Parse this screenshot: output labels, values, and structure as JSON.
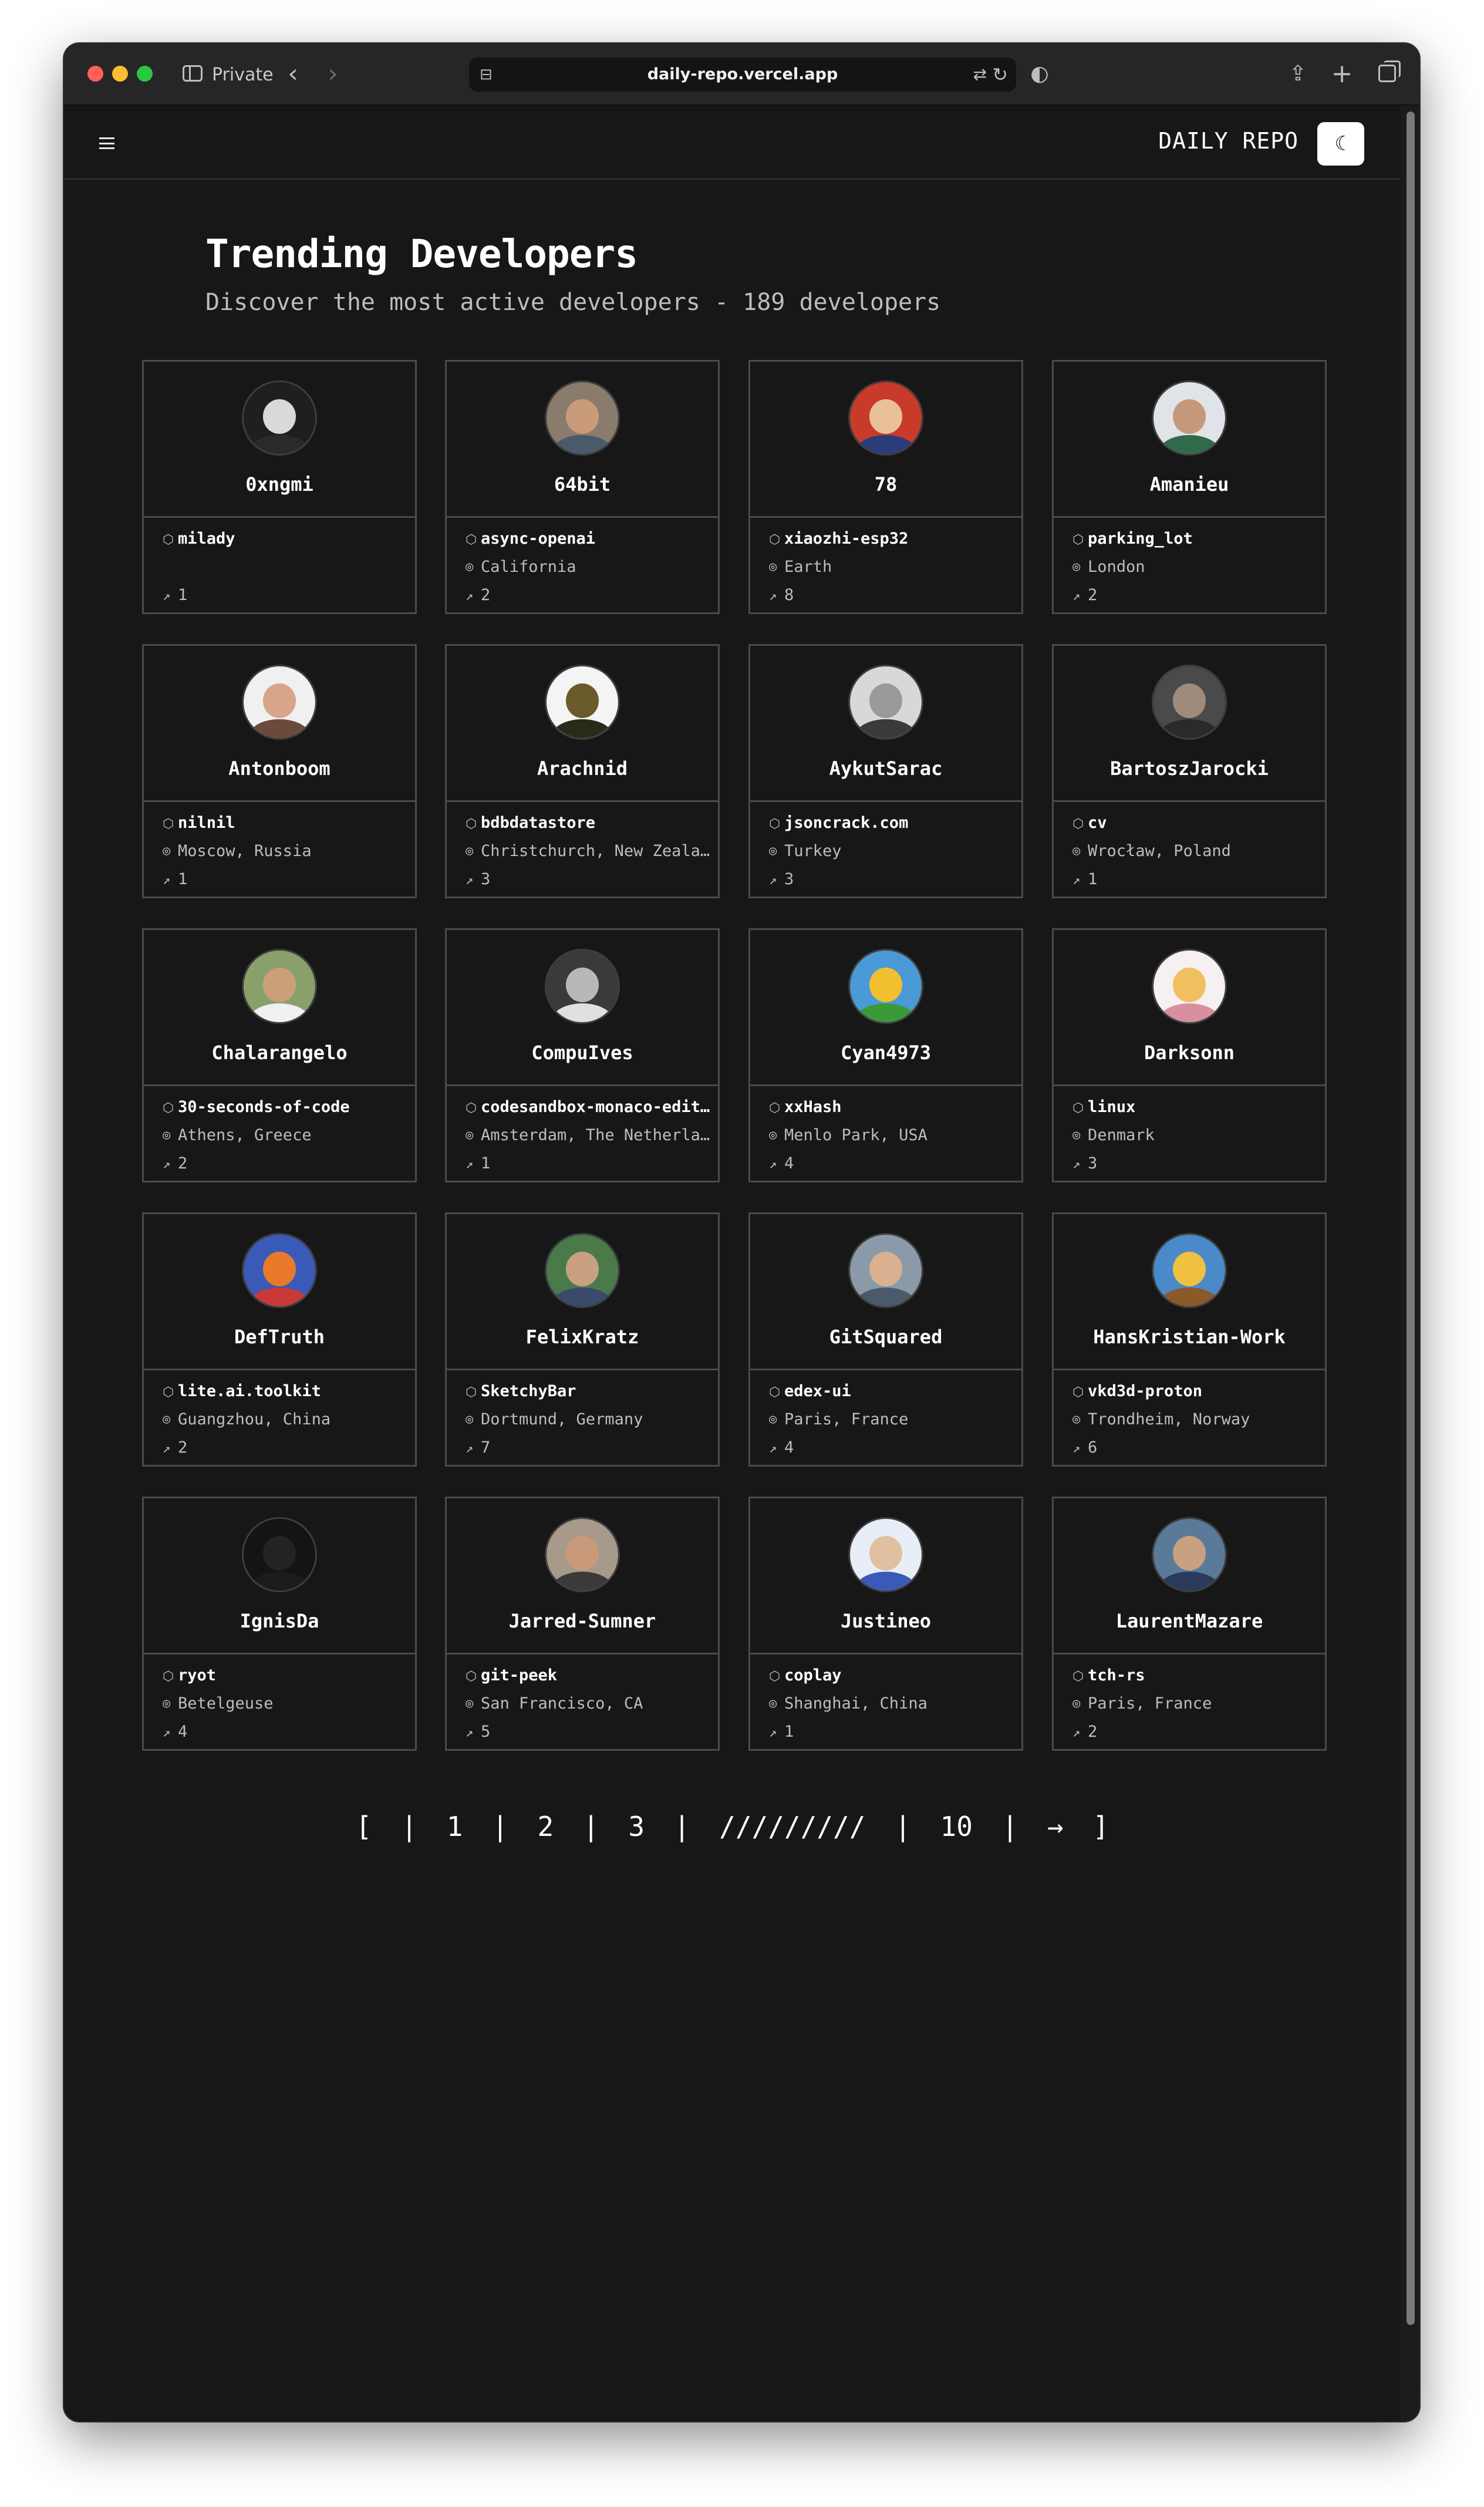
{
  "browser": {
    "private_label": "Private",
    "url": "daily-repo.vercel.app"
  },
  "header": {
    "brand": "DAILY REPO"
  },
  "page": {
    "title": "Trending Developers",
    "subtitle": "Discover the most active developers - 189 developers"
  },
  "developers": [
    {
      "name": "0xngmi",
      "repo": "milady",
      "location": "",
      "trend": "1",
      "bg": "#1f1f1f",
      "face": "#d9d9d9",
      "body": "#2a2a2a"
    },
    {
      "name": "64bit",
      "repo": "async-openai",
      "location": "California",
      "trend": "2",
      "bg": "#8a7c6c",
      "face": "#c99b7a",
      "body": "#4a5a6a"
    },
    {
      "name": "78",
      "repo": "xiaozhi-esp32",
      "location": "Earth",
      "trend": "8",
      "bg": "#c83a2a",
      "face": "#e9c09a",
      "body": "#2b3c7a"
    },
    {
      "name": "Amanieu",
      "repo": "parking_lot",
      "location": "London",
      "trend": "2",
      "bg": "#e0e4e8",
      "face": "#c6987a",
      "body": "#2f6b4b"
    },
    {
      "name": "Antonboom",
      "repo": "nilnil",
      "location": "Moscow, Russia",
      "trend": "1",
      "bg": "#f0f0f0",
      "face": "#d8a58a",
      "body": "#6a4a3a"
    },
    {
      "name": "Arachnid",
      "repo": "bdbdatastore",
      "location": "Christchurch, New Zealand",
      "trend": "3",
      "bg": "#f4f4f4",
      "face": "#6b5a2a",
      "body": "#2a2a1a"
    },
    {
      "name": "AykutSarac",
      "repo": "jsoncrack.com",
      "location": "Turkey",
      "trend": "3",
      "bg": "#d8d8d8",
      "face": "#9a9a9a",
      "body": "#3a3a3a"
    },
    {
      "name": "BartoszJarocki",
      "repo": "cv",
      "location": "Wrocław, Poland",
      "trend": "1",
      "bg": "#4a4a4a",
      "face": "#a08a7a",
      "body": "#2a2a2a"
    },
    {
      "name": "Chalarangelo",
      "repo": "30-seconds-of-code",
      "location": "Athens, Greece",
      "trend": "2",
      "bg": "#8aa06a",
      "face": "#c9a07a",
      "body": "#f0f0f0"
    },
    {
      "name": "CompuIves",
      "repo": "codesandbox-monaco-editor",
      "location": "Amsterdam, The Netherlan…",
      "trend": "1",
      "bg": "#3a3a3a",
      "face": "#b8b8b8",
      "body": "#e0e0e0"
    },
    {
      "name": "Cyan4973",
      "repo": "xxHash",
      "location": "Menlo Park, USA",
      "trend": "4",
      "bg": "#4a9ad8",
      "face": "#f0c030",
      "body": "#3a9a3a"
    },
    {
      "name": "Darksonn",
      "repo": "linux",
      "location": "Denmark",
      "trend": "3",
      "bg": "#f6f0f0",
      "face": "#f0c060",
      "body": "#d890a0"
    },
    {
      "name": "DefTruth",
      "repo": "lite.ai.toolkit",
      "location": "Guangzhou, China",
      "trend": "2",
      "bg": "#3a5ab8",
      "face": "#e87a2a",
      "body": "#c83a3a"
    },
    {
      "name": "FelixKratz",
      "repo": "SketchyBar",
      "location": "Dortmund, Germany",
      "trend": "7",
      "bg": "#4a7a4a",
      "face": "#c9a080",
      "body": "#3a4a6a"
    },
    {
      "name": "GitSquared",
      "repo": "edex-ui",
      "location": "Paris, France",
      "trend": "4",
      "bg": "#8a9aa8",
      "face": "#d9b090",
      "body": "#4a5a6a"
    },
    {
      "name": "HansKristian-Work",
      "repo": "vkd3d-proton",
      "location": "Trondheim, Norway",
      "trend": "6",
      "bg": "#4a8ac8",
      "face": "#f0c040",
      "body": "#8a5a2a"
    },
    {
      "name": "IgnisDa",
      "repo": "ryot",
      "location": "Betelgeuse",
      "trend": "4",
      "bg": "#141414",
      "face": "#232323",
      "body": "#1c1c1c"
    },
    {
      "name": "Jarred-Sumner",
      "repo": "git-peek",
      "location": "San Francisco, CA",
      "trend": "5",
      "bg": "#a89a8a",
      "face": "#c99a7a",
      "body": "#3a3a3a"
    },
    {
      "name": "Justineo",
      "repo": "coplay",
      "location": "Shanghai, China",
      "trend": "1",
      "bg": "#e8eef8",
      "face": "#e0c0a0",
      "body": "#3a5ab8"
    },
    {
      "name": "LaurentMazare",
      "repo": "tch-rs",
      "location": "Paris, France",
      "trend": "2",
      "bg": "#5a7a9a",
      "face": "#c9a080",
      "body": "#2a3a5a"
    }
  ],
  "pagination": {
    "open": "[",
    "p1": "1",
    "p2": "2",
    "p3": "3",
    "ellipsis": "/////////",
    "p10": "10",
    "next": "→",
    "close": "]",
    "sep": "|"
  },
  "icons": {
    "repo": "repo-icon",
    "location": "location-pin-icon",
    "trend": "trending-icon"
  }
}
